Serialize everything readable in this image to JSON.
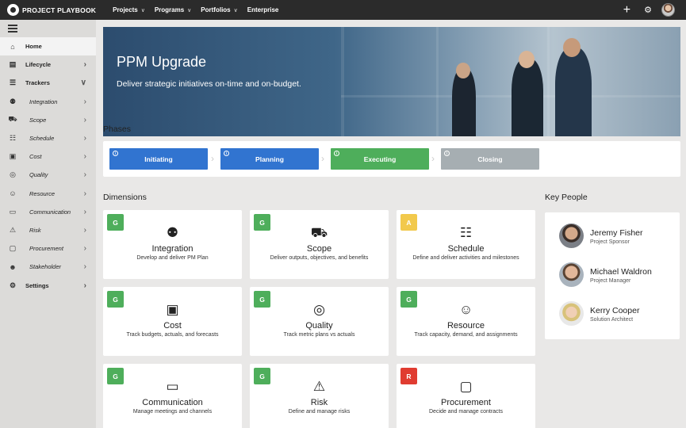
{
  "topbar": {
    "logo_text": "PROJECT PLAYBOOK",
    "nav": [
      {
        "label": "Projects",
        "has_caret": true
      },
      {
        "label": "Programs",
        "has_caret": true
      },
      {
        "label": "Portfolios",
        "has_caret": true
      },
      {
        "label": "Enterprise",
        "has_caret": false
      }
    ],
    "icons": [
      "plus-icon",
      "gear-icon",
      "user-avatar"
    ]
  },
  "sidebar": {
    "items": [
      {
        "label": "Home",
        "icon": "home-icon",
        "active": true
      },
      {
        "label": "Lifecycle",
        "icon": "lifecycle-icon",
        "chevron": "right"
      },
      {
        "label": "Trackers",
        "icon": "trackers-icon",
        "chevron": "down"
      },
      {
        "label": "Integration",
        "icon": "integration-icon",
        "chevron": "right",
        "sub": true
      },
      {
        "label": "Scope",
        "icon": "truck-icon",
        "chevron": "right",
        "sub": true
      },
      {
        "label": "Schedule",
        "icon": "schedule-icon",
        "chevron": "right",
        "sub": true
      },
      {
        "label": "Cost",
        "icon": "money-icon",
        "chevron": "right",
        "sub": true
      },
      {
        "label": "Quality",
        "icon": "target-icon",
        "chevron": "right",
        "sub": true
      },
      {
        "label": "Resource",
        "icon": "people-add-icon",
        "chevron": "right",
        "sub": true
      },
      {
        "label": "Communication",
        "icon": "chat-icon",
        "chevron": "right",
        "sub": true
      },
      {
        "label": "Risk",
        "icon": "warning-icon",
        "chevron": "right",
        "sub": true
      },
      {
        "label": "Procurement",
        "icon": "bag-icon",
        "chevron": "right",
        "sub": true
      },
      {
        "label": "Stakeholder",
        "icon": "stakeholder-icon",
        "chevron": "right",
        "sub": true
      },
      {
        "label": "Settings",
        "icon": "gear-icon",
        "chevron": "right"
      }
    ]
  },
  "hero": {
    "title": "PPM Upgrade",
    "subtitle": "Deliver strategic initiatives on-time and on-budget."
  },
  "phases": {
    "title": "Phases",
    "items": [
      {
        "label": "Initiating",
        "color": "#3174d0"
      },
      {
        "label": "Planning",
        "color": "#3174d0"
      },
      {
        "label": "Executing",
        "color": "#4eae5b"
      },
      {
        "label": "Closing",
        "color": "#a6aeb2"
      }
    ]
  },
  "dimensions": {
    "title": "Dimensions",
    "status_colors": {
      "G": "#4eae5b",
      "A": "#f2c94c",
      "R": "#e03c31"
    },
    "cards": [
      {
        "status": "G",
        "icon": "integration-icon",
        "title": "Integration",
        "desc": "Develop and deliver PM Plan"
      },
      {
        "status": "G",
        "icon": "truck-icon",
        "title": "Scope",
        "desc": "Deliver outputs, objectives, and benefits"
      },
      {
        "status": "A",
        "icon": "schedule-icon",
        "title": "Schedule",
        "desc": "Define and deliver activities and milestones"
      },
      {
        "status": "G",
        "icon": "money-icon",
        "title": "Cost",
        "desc": "Track budgets, actuals, and forecasts"
      },
      {
        "status": "G",
        "icon": "target-icon",
        "title": "Quality",
        "desc": "Track metric plans vs actuals"
      },
      {
        "status": "G",
        "icon": "people-add-icon",
        "title": "Resource",
        "desc": "Track capacity, demand, and assignments"
      },
      {
        "status": "G",
        "icon": "chat-icon",
        "title": "Communication",
        "desc": "Manage meetings and channels"
      },
      {
        "status": "G",
        "icon": "warning-icon",
        "title": "Risk",
        "desc": "Define and manage risks"
      },
      {
        "status": "R",
        "icon": "bag-icon",
        "title": "Procurement",
        "desc": "Decide and manage contracts"
      }
    ]
  },
  "key_people": {
    "title": "Key People",
    "people": [
      {
        "name": "Jeremy Fisher",
        "role": "Project Sponsor"
      },
      {
        "name": "Michael Waldron",
        "role": "Project Manager"
      },
      {
        "name": "Kerry Cooper",
        "role": "Solution Architect"
      }
    ]
  }
}
